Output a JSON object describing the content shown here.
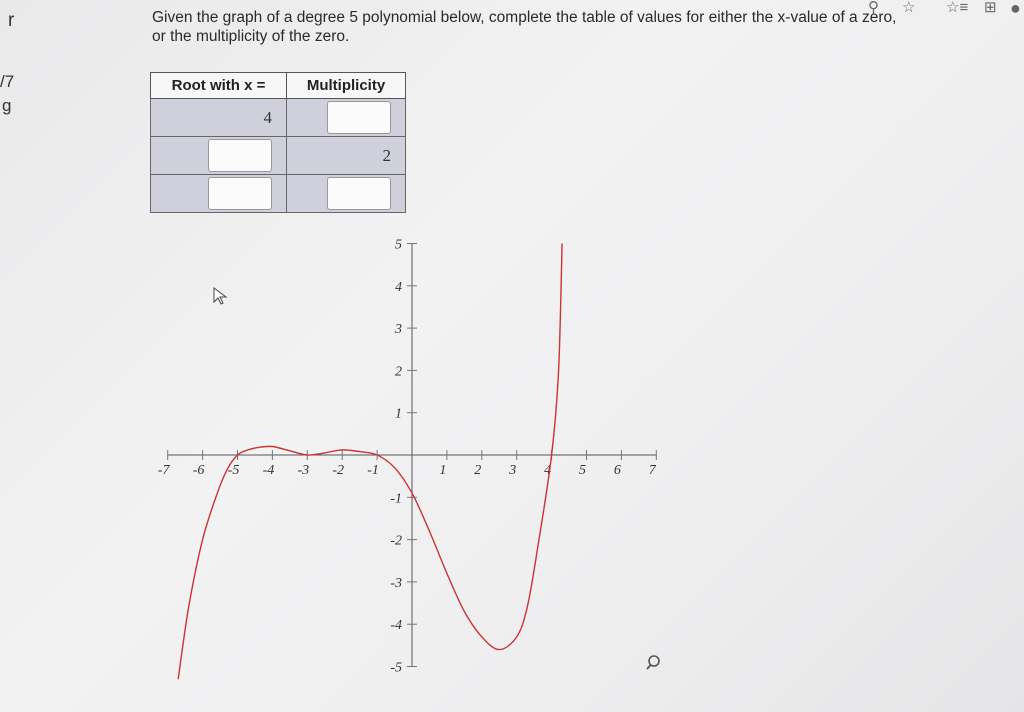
{
  "edge": {
    "r": "r",
    "n7": "/7",
    "g": "g"
  },
  "toolbar": {
    "icons": [
      "search-icon",
      "star-icon",
      "favorites-list-icon",
      "collections-icon",
      "profile-icon"
    ]
  },
  "question": "Given the graph of a degree 5 polynomial below, complete the table of values for either the x-value of a zero, or the multiplicity of the zero.",
  "table": {
    "headers": [
      "Root with x =",
      "Multiplicity"
    ],
    "rows": [
      {
        "root": "4",
        "multiplicity": ""
      },
      {
        "root": "",
        "multiplicity": "2"
      },
      {
        "root": "",
        "multiplicity": ""
      }
    ]
  },
  "chart_data": {
    "type": "line",
    "title": "",
    "xlabel": "",
    "ylabel": "",
    "xlim": [
      -7,
      7
    ],
    "ylim": [
      -5,
      5
    ],
    "x_ticks": [
      "-7",
      "-6",
      "-5",
      "-4",
      "-3",
      "-2",
      "-1",
      "1",
      "2",
      "3",
      "4",
      "5",
      "6",
      "7"
    ],
    "y_ticks": [
      "5",
      "4",
      "3",
      "2",
      "1",
      "-1",
      "-2",
      "-3",
      "-4",
      "-5"
    ],
    "series": [
      {
        "color": "#cc3333",
        "x": [
          -6.7,
          -6.4,
          -6.0,
          -5.6,
          -5.3,
          -5.0,
          -4.7,
          -4.4,
          -4.0,
          -3.5,
          -3.0,
          -2.5,
          -2.0,
          -1.5,
          -1.0,
          -0.5,
          0.0,
          0.5,
          1.0,
          1.5,
          2.0,
          2.5,
          3.0,
          3.3,
          3.6,
          4.0,
          4.2,
          4.3
        ],
        "y": [
          -5.3,
          -3.6,
          -2.0,
          -0.95,
          -0.35,
          0.0,
          0.12,
          0.18,
          0.2,
          0.1,
          0.0,
          0.05,
          0.12,
          0.08,
          0.0,
          -0.3,
          -0.9,
          -1.8,
          -2.8,
          -3.7,
          -4.3,
          -4.6,
          -4.3,
          -3.6,
          -2.2,
          0.0,
          2.0,
          5.0
        ]
      }
    ],
    "grid": false
  }
}
